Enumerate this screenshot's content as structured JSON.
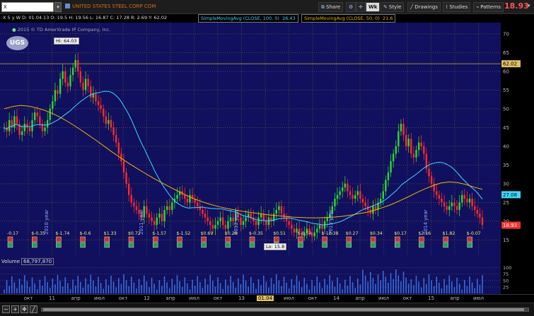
{
  "toolbar": {
    "symbol_value": "X",
    "company_name": "UNITED STATES STEEL CORP COM",
    "share_label": "Share",
    "period_label": "Wk",
    "style_label": "Style",
    "drawings_label": "Drawings",
    "studies_label": "Studies",
    "patterns_label": "Patterns",
    "last_price": "18.93"
  },
  "infobar": {
    "ohlc": "X 5 y W   D: 01.04.13   O: 19.5   H: 19.56   L: 16.87   C: 17.28   R: 2.69   Y: 62.02",
    "sma100_label": "SimpleMovingAvg (CLOSE, 100, 0)",
    "sma100_value": "26.43",
    "sma50_label": "SimpleMovingAvg (CLOSE, 50, 0)",
    "sma50_value": "21.6"
  },
  "chart": {
    "copyright": "2015 © TD Ameritrade IP Company, Inc.",
    "logo": "UGS",
    "hi_label": "Hi: 64.03",
    "lo_label": "Lo: 15.8",
    "y_ticks": [
      "70",
      "65",
      "60",
      "55",
      "50",
      "45",
      "40",
      "35",
      "30",
      "25",
      "20",
      "15"
    ],
    "hline_value": "62.02",
    "sma100_badge": "27.08",
    "last_badge": "18.93",
    "earnings": [
      "-0.17",
      "$-0.35",
      "$-1.74",
      "$-0.6",
      "$1.33",
      "$0.72",
      "$-1.57",
      "$-1.52",
      "$0.69",
      "$0.28",
      "$-0.35",
      "$0.51",
      "$-0.54",
      "$-12.38",
      "$0.27",
      "$0.34",
      "$0.17",
      "$2.16",
      "$1.82",
      "$-0.07"
    ],
    "year_labels": [
      "2010 year",
      "2011 year",
      "2012 year",
      "2013 year",
      "2014 year"
    ],
    "x_ticks": [
      "окт",
      "11",
      "апр",
      "июл",
      "окт",
      "12",
      "апр",
      "июл",
      "окт",
      "13",
      "01.04",
      "июл",
      "окт",
      "14",
      "апр",
      "июл",
      "окт",
      "15",
      "апр",
      "июл"
    ],
    "colors": {
      "bg": "#10105e",
      "grid": "#7a6a28",
      "up": "#2fd92f",
      "down": "#ff2a2a",
      "sma100": "#40d8ff",
      "sma50": "#f2b200"
    }
  },
  "volume": {
    "label": "Volume",
    "value": "68,797,870",
    "y_ticks": [
      "100",
      "75",
      "50",
      "25"
    ]
  },
  "chart_data": {
    "type": "candlestick",
    "title": "UNITED STATES STEEL CORP COM",
    "ylim": [
      13,
      73
    ],
    "high": 64.03,
    "low": 15.8,
    "last": 18.93,
    "hline": 62.02,
    "sma100_last": 27.08,
    "volume_ylim": [
      0,
      110
    ],
    "close": [
      45,
      44,
      47,
      45,
      48,
      46,
      43,
      44,
      46,
      45,
      44,
      47,
      49,
      48,
      46,
      44,
      45,
      47,
      50,
      52,
      55,
      54,
      58,
      60,
      57,
      56,
      59,
      61,
      63,
      60,
      57,
      55,
      58,
      56,
      53,
      54,
      52,
      51,
      50,
      48,
      46,
      47,
      45,
      43,
      41,
      38,
      36,
      33,
      30,
      27,
      25,
      24,
      23,
      22,
      21,
      24,
      22,
      21,
      20,
      19,
      21,
      22,
      20,
      23,
      24,
      23,
      25,
      26,
      27,
      28,
      27,
      26,
      25,
      27,
      26,
      25,
      24,
      23,
      22,
      21,
      20,
      19,
      18,
      19,
      20,
      21,
      19,
      18,
      20,
      21,
      20,
      22,
      21,
      19,
      20,
      21,
      22,
      21,
      20,
      19,
      21,
      22,
      20,
      19,
      21,
      20,
      22,
      23,
      24,
      22,
      21,
      20,
      19,
      18,
      17,
      18,
      17,
      16,
      17,
      18,
      17,
      16,
      17,
      18,
      19,
      18,
      20,
      21,
      22,
      24,
      26,
      27,
      28,
      29,
      30,
      28,
      27,
      26,
      27,
      28,
      26,
      25,
      24,
      23,
      22,
      24,
      23,
      25,
      26,
      28,
      31,
      33,
      36,
      38,
      40,
      44,
      46,
      43,
      40,
      42,
      38,
      37,
      39,
      41,
      40,
      38,
      34,
      32,
      30,
      28,
      27,
      26,
      25,
      24,
      23,
      24,
      25,
      24,
      23,
      25,
      27,
      26,
      25,
      26,
      24,
      23,
      22,
      21,
      19
    ],
    "sma50": [
      50,
      50.6,
      50.9,
      50.7,
      50.2,
      49.5,
      48.6,
      47.5,
      46.2,
      44.8,
      43.3,
      41.8,
      40.2,
      38.6,
      37.1,
      35.6,
      34.2,
      32.9,
      31.6,
      30.4,
      29.2,
      28.1,
      27,
      26,
      25.2,
      24.5,
      23.9,
      23.4,
      23,
      22.6,
      22.3,
      22,
      21.7,
      21.5,
      21.3,
      21.1,
      21,
      20.9,
      20.9,
      21,
      21.1,
      21.3,
      21.6,
      22,
      22.4,
      23,
      23.7,
      24.5,
      25.5,
      26.5,
      27.6,
      28.6,
      29.5,
      30.2,
      30.5,
      30.3,
      29.8,
      29.1,
      28.5
    ]
  }
}
